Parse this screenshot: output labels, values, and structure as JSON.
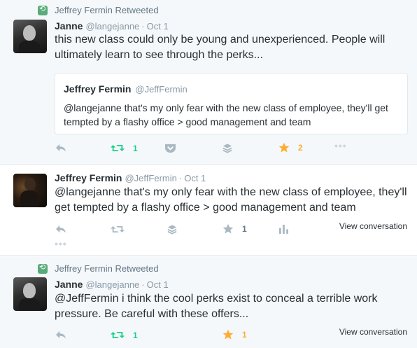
{
  "tweets": [
    {
      "retweeted_by": "Jeffrey Fermin Retweeted",
      "name": "Janne",
      "handle": "@langejanne",
      "time": "Oct 1",
      "text": "this new class could only be young and unexperienced. People will ultimately learn to see through the perks...",
      "quote": {
        "name": "Jeffrey Fermin",
        "handle": "@JeffFermin",
        "text": "@langejanne that's my only fear with the new class of employee, they'll get tempted by a flashy office > good management and team"
      },
      "retweet_count": "1",
      "like_count": "2"
    },
    {
      "name": "Jeffrey Fermin",
      "handle": "@JeffFermin",
      "time": "Oct 1",
      "text": "@langejanne that's my only fear with the new class of employee, they'll get tempted by a flashy office > good management and team",
      "like_count": "1",
      "view_conversation": "View conversation"
    },
    {
      "retweeted_by": "Jeffrey Fermin Retweeted",
      "name": "Janne",
      "handle": "@langejanne",
      "time": "Oct 1",
      "text": "@JeffFermin i think the cool perks exist to conceal a terrible work pressure. Be careful with these offers...",
      "retweet_count": "1",
      "like_count": "1",
      "view_conversation": "View conversation"
    }
  ],
  "colors": {
    "retweet_active": "#19cf86",
    "like_active": "#ffac33",
    "icon_grey": "#aab8c2",
    "bg_highlight": "#f5f8fa",
    "border": "#e1e8ed"
  },
  "icons": [
    "retweet-badge-icon",
    "reply-icon",
    "retweet-icon",
    "pocket-icon",
    "buffer-icon",
    "star-icon",
    "more-icon",
    "analytics-icon"
  ]
}
